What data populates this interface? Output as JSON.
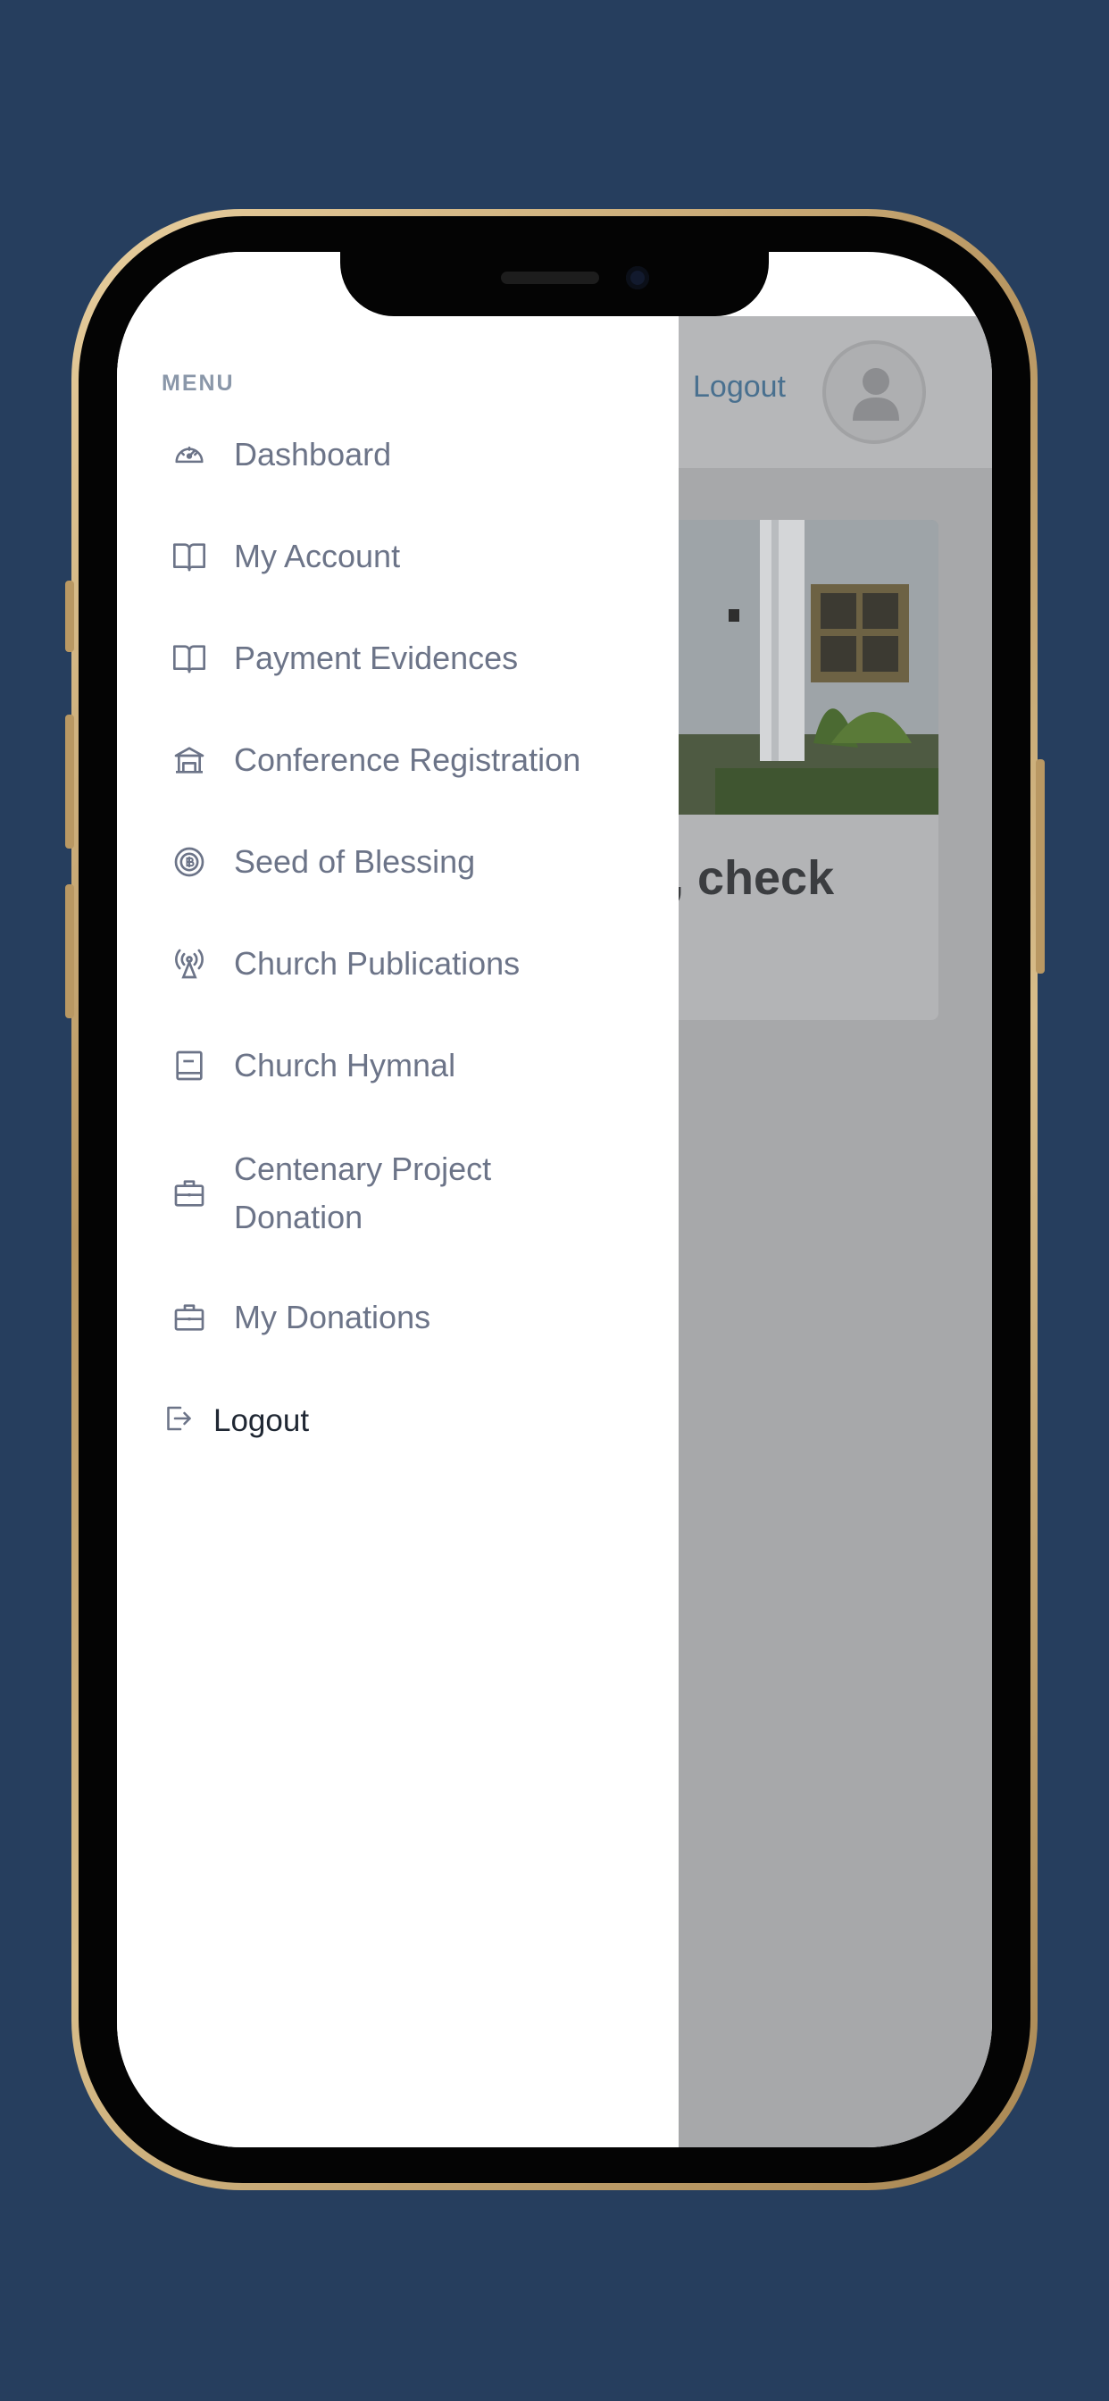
{
  "menu": {
    "heading": "MENU",
    "items": [
      {
        "label": "Dashboard",
        "icon": "speedometer-icon"
      },
      {
        "label": "My Account",
        "icon": "book-icon"
      },
      {
        "label": "Payment Evidences",
        "icon": "book-icon"
      },
      {
        "label": "Conference Registration",
        "icon": "building-icon"
      },
      {
        "label": "Seed of Blessing",
        "icon": "coin-icon"
      },
      {
        "label": "Church Publications",
        "icon": "broadcast-icon"
      },
      {
        "label": "Church Hymnal",
        "icon": "hymnal-book-icon"
      },
      {
        "label": "Centenary Project Donation",
        "icon": "briefcase-icon"
      },
      {
        "label": "My Donations",
        "icon": "briefcase-icon"
      }
    ],
    "logout_label": "Logout"
  },
  "background_app": {
    "header_logout": "Logout",
    "card_text": ", check"
  },
  "colors": {
    "page_background": "#263e5e",
    "menu_text": "#6c7488",
    "overlay": "#a7a8aa",
    "link": "#49708f"
  }
}
